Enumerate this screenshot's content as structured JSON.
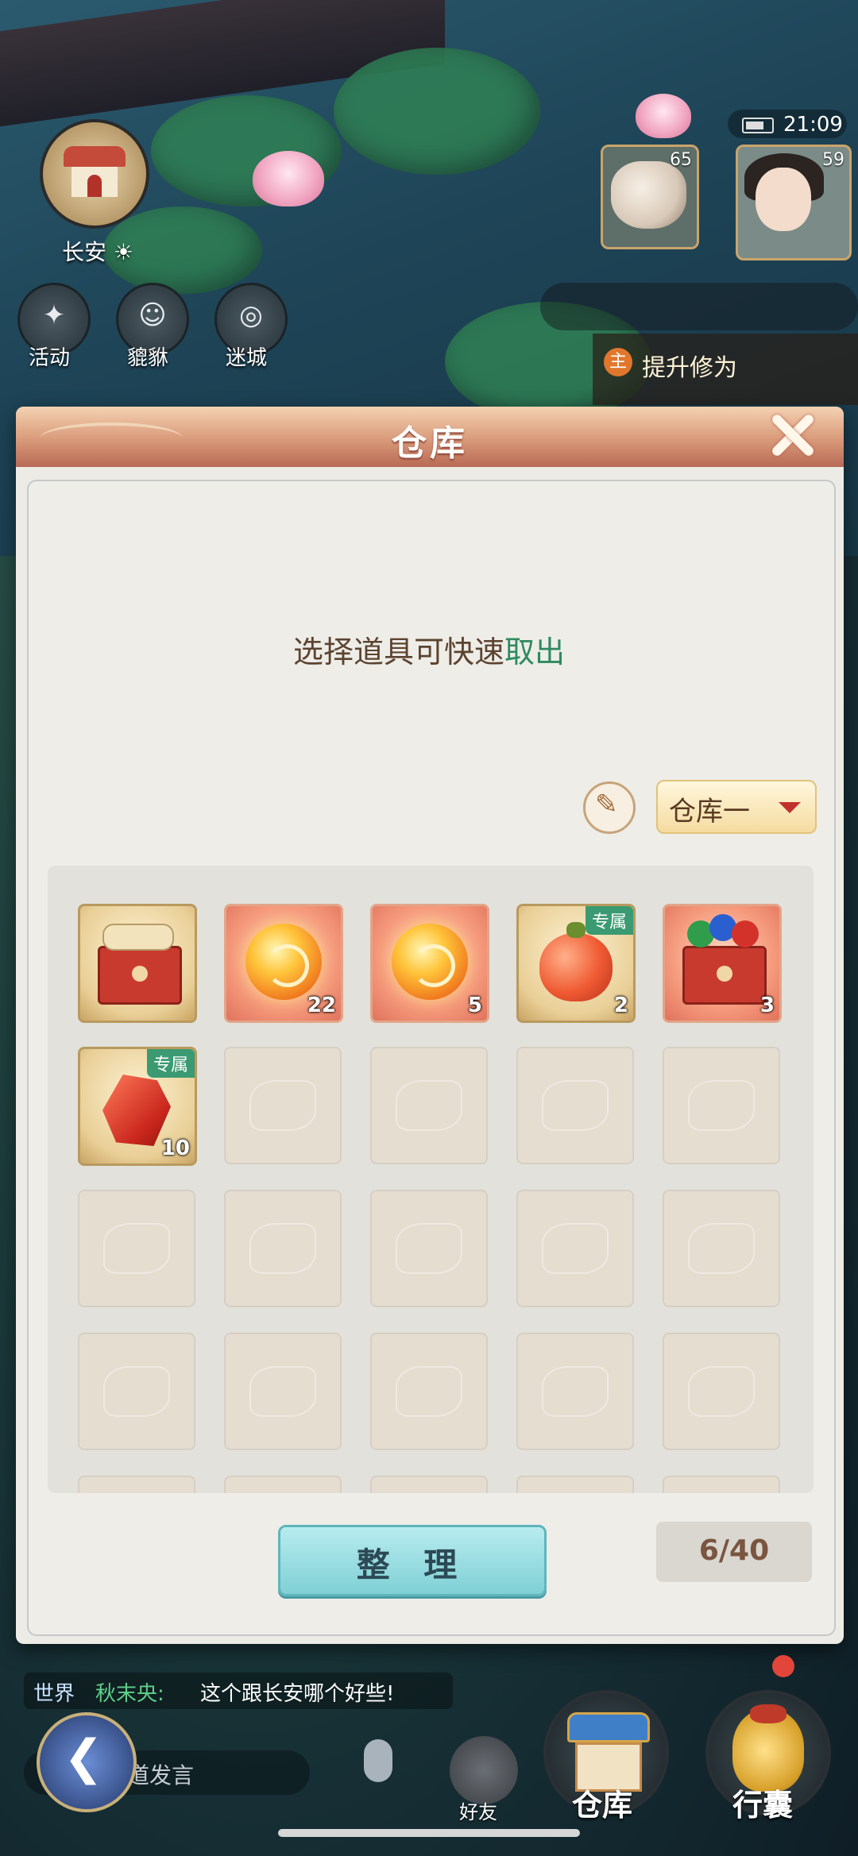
{
  "hud": {
    "city": {
      "name": "长安",
      "weather_icon": "sun-icon"
    },
    "shortcuts": [
      {
        "label": "活动",
        "icon": "gift-icon"
      },
      {
        "label": "貔貅",
        "icon": "pixiu-icon"
      },
      {
        "label": "迷城",
        "icon": "maze-icon"
      }
    ],
    "clock": "21:09",
    "pet_level": "65",
    "hero_level": "59",
    "quest": {
      "badge": "主",
      "text": "提升修为"
    }
  },
  "warehouse": {
    "title": "仓库",
    "hint_prefix": "选择道具可快速",
    "hint_action": "取出",
    "selector": {
      "selected": "仓库一"
    },
    "capacity": "6/40",
    "sort_label": "整 理",
    "tag_exclusive": "专属",
    "items": [
      {
        "name": "scroll-chest",
        "count": ""
      },
      {
        "name": "fire-orb",
        "count": "22"
      },
      {
        "name": "fire-orb",
        "count": "5"
      },
      {
        "name": "red-fruit",
        "count": "2",
        "exclusive": true
      },
      {
        "name": "gem-chest",
        "count": "3"
      },
      {
        "name": "red-crystal",
        "count": "10",
        "exclusive": true
      }
    ],
    "colors": {
      "accent_green": "#2e8a60",
      "header": "#d99a7a",
      "sort_button": "#7fd0d5"
    }
  },
  "bottom": {
    "chat": {
      "channel": "世界",
      "user": "秋末央:",
      "message": "这个跟长安哪个好些!"
    },
    "speak_placeholder": "道发言",
    "friend_label": "好友",
    "warehouse_label": "仓库",
    "bag_label": "行囊"
  }
}
